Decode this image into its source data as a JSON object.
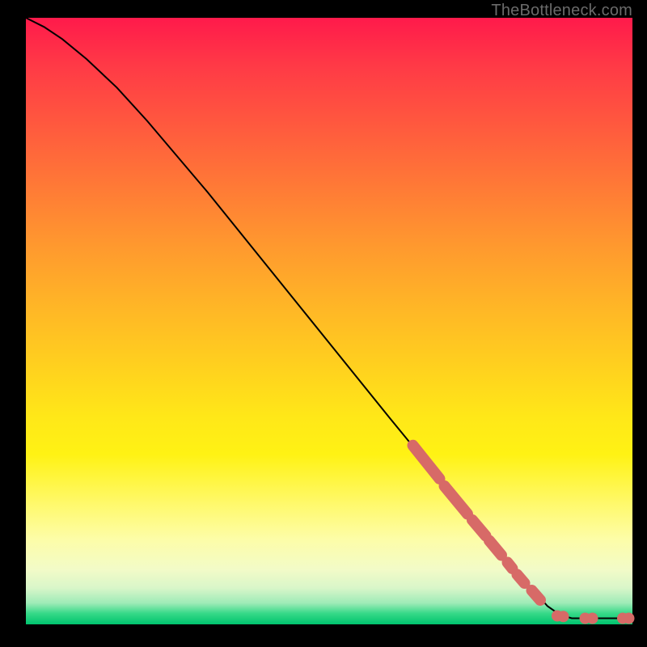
{
  "watermark": "TheBottleneck.com",
  "colors": {
    "dot_fill": "#d76a67",
    "curve_stroke": "#000000"
  },
  "chart_data": {
    "type": "line",
    "title": "",
    "xlabel": "",
    "ylabel": "",
    "xlim": [
      0,
      100
    ],
    "ylim": [
      0,
      100
    ],
    "grid": false,
    "curve": [
      {
        "x": 0,
        "y": 100
      },
      {
        "x": 3,
        "y": 98.5
      },
      {
        "x": 6,
        "y": 96.5
      },
      {
        "x": 10,
        "y": 93.2
      },
      {
        "x": 15,
        "y": 88.5
      },
      {
        "x": 20,
        "y": 83.0
      },
      {
        "x": 30,
        "y": 71.2
      },
      {
        "x": 40,
        "y": 58.8
      },
      {
        "x": 50,
        "y": 46.4
      },
      {
        "x": 60,
        "y": 34.0
      },
      {
        "x": 70,
        "y": 21.8
      },
      {
        "x": 80,
        "y": 9.8
      },
      {
        "x": 86,
        "y": 3.0
      },
      {
        "x": 88,
        "y": 1.6
      },
      {
        "x": 90,
        "y": 1.0
      },
      {
        "x": 95,
        "y": 1.0
      },
      {
        "x": 100,
        "y": 1.0
      }
    ],
    "dot_clusters": [
      {
        "x1": 63.8,
        "y1": 29.5,
        "x2": 68.2,
        "y2": 24.0
      },
      {
        "x1": 69.0,
        "y1": 22.8,
        "x2": 72.8,
        "y2": 18.2
      },
      {
        "x1": 73.6,
        "y1": 17.2,
        "x2": 75.8,
        "y2": 14.6
      },
      {
        "x1": 76.4,
        "y1": 13.8,
        "x2": 78.4,
        "y2": 11.4
      },
      {
        "x1": 79.4,
        "y1": 10.2,
        "x2": 80.2,
        "y2": 9.2
      },
      {
        "x1": 81.0,
        "y1": 8.2,
        "x2": 82.2,
        "y2": 6.8
      },
      {
        "x1": 83.4,
        "y1": 5.6,
        "x2": 84.8,
        "y2": 4.0
      }
    ],
    "flat_dots": [
      {
        "x": 87.6,
        "y": 1.4
      },
      {
        "x": 88.6,
        "y": 1.3
      },
      {
        "x": 92.2,
        "y": 1.0
      },
      {
        "x": 93.4,
        "y": 1.0
      },
      {
        "x": 98.4,
        "y": 1.0
      },
      {
        "x": 99.4,
        "y": 1.0
      }
    ]
  }
}
